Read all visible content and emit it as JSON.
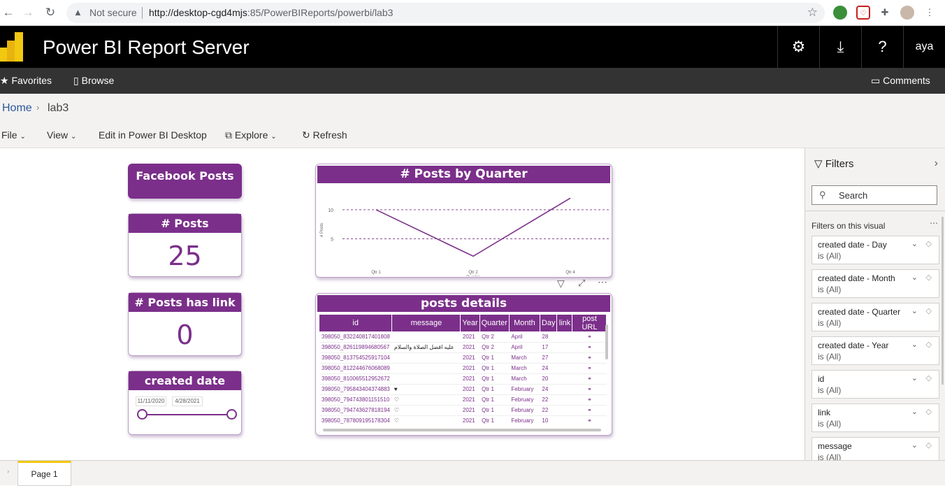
{
  "browser": {
    "not_secure": "Not secure",
    "url_host": "http://desktop-cgd4mjs",
    "url_rest": ":85/PowerBIReports/powerbi/lab3"
  },
  "header": {
    "title": "Power BI Report Server",
    "user": "aya"
  },
  "nav": {
    "favorites": "Favorites",
    "browse": "Browse",
    "comments": "Comments"
  },
  "breadcrumb": {
    "home": "Home",
    "current": "lab3"
  },
  "toolbar": {
    "file": "File",
    "view": "View",
    "edit": "Edit in Power BI Desktop",
    "explore": "Explore",
    "refresh": "Refresh"
  },
  "report": {
    "title_card": "Facebook Posts",
    "kpi_posts": {
      "label": "# Posts",
      "value": "25"
    },
    "kpi_links": {
      "label": "# Posts has link",
      "value": "0"
    },
    "slicer": {
      "label": "created date",
      "start": "11/11/2020",
      "end": "4/28/2021"
    },
    "table": {
      "title": "posts details",
      "columns": [
        "id",
        "message",
        "Year",
        "Quarter",
        "Month",
        "Day",
        "link",
        "post URL"
      ],
      "rows": [
        {
          "id": "398050_832240817401808",
          "message": "",
          "year": "2021",
          "quarter": "Qtr 2",
          "month": "April",
          "day": "28"
        },
        {
          "id": "398050_826119894680567",
          "message": "عليه افضل الصلاة والسلام",
          "year": "2021",
          "quarter": "Qtr 2",
          "month": "April",
          "day": "17"
        },
        {
          "id": "398050_813754525917104",
          "message": "",
          "year": "2021",
          "quarter": "Qtr 1",
          "month": "March",
          "day": "27"
        },
        {
          "id": "398050_812244676068089",
          "message": "",
          "year": "2021",
          "quarter": "Qtr 1",
          "month": "March",
          "day": "24"
        },
        {
          "id": "398050_810065512952672",
          "message": "",
          "year": "2021",
          "quarter": "Qtr 1",
          "month": "March",
          "day": "20"
        },
        {
          "id": "398050_795843404374883",
          "message": "♥",
          "year": "2021",
          "quarter": "Qtr 1",
          "month": "February",
          "day": "24"
        },
        {
          "id": "398050_794743801151510",
          "message": "♡",
          "year": "2021",
          "quarter": "Qtr 1",
          "month": "February",
          "day": "22"
        },
        {
          "id": "398050_794743627818194",
          "message": "♡",
          "year": "2021",
          "quarter": "Qtr 1",
          "month": "February",
          "day": "22"
        },
        {
          "id": "398050_787809195178304",
          "message": "♡",
          "year": "2021",
          "quarter": "Qtr 1",
          "month": "February",
          "day": "10"
        }
      ]
    }
  },
  "chart_data": {
    "type": "line",
    "title": "# Posts by Quarter",
    "xlabel": "Quarter",
    "ylabel": "# Posts",
    "categories": [
      "Qtr 1",
      "Qtr 2",
      "Qtr 4"
    ],
    "values": [
      10,
      2,
      12
    ],
    "yticks": [
      "10",
      "5"
    ],
    "ylim": [
      0,
      13
    ],
    "grid": true,
    "color": "#7b2f8a"
  },
  "filters": {
    "title": "Filters",
    "search_placeholder": "Search",
    "section": "Filters on this visual",
    "items": [
      {
        "name": "created date - Day",
        "value": "is (All)"
      },
      {
        "name": "created date - Month",
        "value": "is (All)"
      },
      {
        "name": "created date - Quarter",
        "value": "is (All)"
      },
      {
        "name": "created date - Year",
        "value": "is (All)"
      },
      {
        "name": "id",
        "value": "is (All)"
      },
      {
        "name": "link",
        "value": "is (All)"
      },
      {
        "name": "message",
        "value": "is (All)"
      }
    ]
  },
  "footer": {
    "page": "Page 1"
  },
  "colors": {
    "accent": "#7b2f8a",
    "header_bg": "#000000",
    "nav_bg": "#333333",
    "logo_yellow": "#f2c811"
  }
}
